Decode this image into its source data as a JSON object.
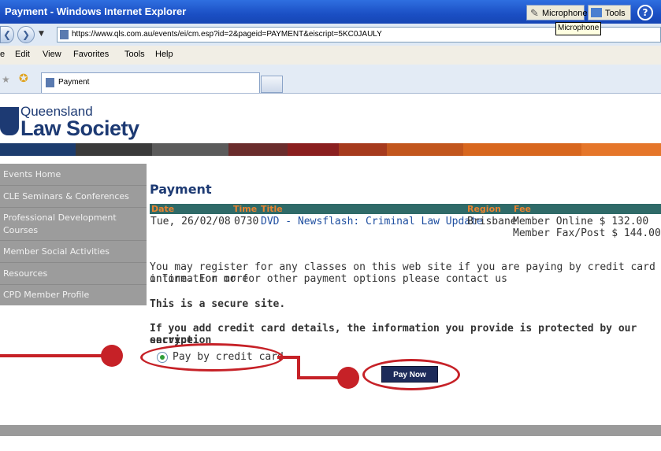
{
  "window": {
    "title": "Payment - Windows Internet Explorer",
    "microphone_label": "Microphone",
    "tools_label": "Tools",
    "tooltip": "Microphone",
    "help_glyph": "?"
  },
  "address": {
    "url": "https://www.qls.com.au/events/ei/cm.esp?id=2&pageid=PAYMENT&eiscript=5KC0JAULY"
  },
  "menu": [
    "e",
    "Edit",
    "View",
    "Favorites",
    "Tools",
    "Help"
  ],
  "tab": {
    "label": "Payment"
  },
  "logo": {
    "line1": "Queensland",
    "line2": "Law Society"
  },
  "colors": {
    "strip": [
      "#1c3c6e",
      "#3a3a3a",
      "#5b5b5b",
      "#6a2c2c",
      "#8a1f1f",
      "#a63a1d",
      "#c2561d",
      "#d8671e",
      "#e5762a"
    ],
    "accent": "#1d3a73",
    "annotation": "#c62127"
  },
  "sidebar": {
    "items": [
      {
        "label": "Events Home"
      },
      {
        "label": "CLE Seminars & Conferences"
      },
      {
        "label": "Professional Development Courses"
      },
      {
        "label": "Member Social Activities"
      },
      {
        "label": "Resources"
      },
      {
        "label": "CPD Member Profile"
      }
    ]
  },
  "main": {
    "title": "Payment",
    "table": {
      "headers": {
        "date": "Date",
        "time": "Time",
        "title": "Title",
        "region": "Region",
        "fee": "Fee"
      },
      "row": {
        "date": "Tue, 26/02/08",
        "time": "0730",
        "title": "DVD - Newsflash: Criminal Law Update",
        "region": "Brisbane",
        "fee1": "Member Online $ 132.00",
        "fee2": "Member Fax/Post $ 144.00"
      }
    },
    "info_line1": "You may register for any classes on this web site if you are paying by credit card online. For more",
    "info_line2": "information or for other payment options please contact us",
    "secure": "This is a secure site.",
    "protect_line1": "If you add credit card details, the information you provide is protected by our encryption",
    "protect_line2": "service.",
    "radio_label": "Pay by credit card",
    "pay_button": "Pay Now"
  }
}
